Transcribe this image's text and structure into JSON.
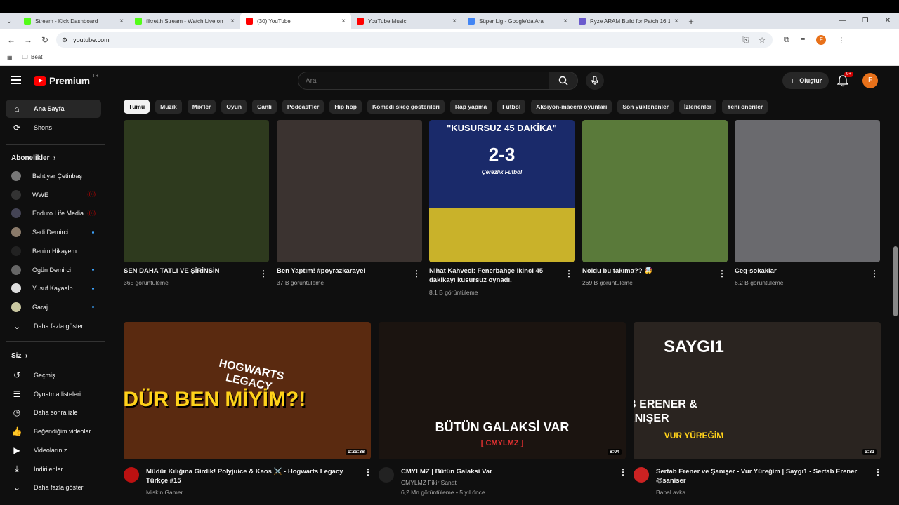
{
  "browser": {
    "tabs": [
      {
        "title": "Stream - Kick Dashboard",
        "color": "#53fc18",
        "active": false
      },
      {
        "title": "fikretth Stream - Watch Live on",
        "color": "#53fc18",
        "active": false
      },
      {
        "title": "(30) YouTube",
        "color": "#ff0000",
        "active": true
      },
      {
        "title": "YouTube Music",
        "color": "#ff0000",
        "active": false
      },
      {
        "title": "Süper Lig - Google'da Ara",
        "color": "#4285f4",
        "active": false
      },
      {
        "title": "Ryze ARAM Build for Patch 16.1",
        "color": "#6a5acd",
        "active": false
      }
    ],
    "url": "youtube.com",
    "bookmark": "Beat",
    "profile_initial": "F"
  },
  "header": {
    "logo": "Premium",
    "logo_sup": "TR",
    "search_placeholder": "Ara",
    "create_label": "Oluştur",
    "notif_badge": "9+",
    "avatar_initial": "F"
  },
  "sidebar": {
    "main": [
      {
        "label": "Ana Sayfa",
        "icon": "home-icon"
      },
      {
        "label": "Shorts",
        "icon": "shorts-icon"
      }
    ],
    "subs_title": "Abonelikler",
    "subs": [
      {
        "label": "Bahtiyar Çetinbaş",
        "color": "#777",
        "status": ""
      },
      {
        "label": "WWE",
        "color": "#333",
        "status": "live"
      },
      {
        "label": "Enduro Life Media",
        "color": "#445",
        "status": "live"
      },
      {
        "label": "Sadi Demirci",
        "color": "#8a7a6a",
        "status": "dot"
      },
      {
        "label": "Benim Hikayem",
        "color": "#222",
        "status": ""
      },
      {
        "label": "Ogün Demirci",
        "color": "#666",
        "status": "dot"
      },
      {
        "label": "Yusuf Kayaalp",
        "color": "#ddd",
        "status": "dot"
      },
      {
        "label": "Garaj",
        "color": "#c9c7a0",
        "status": "dot"
      }
    ],
    "subs_more": "Daha fazla göster",
    "you_title": "Siz",
    "you": [
      {
        "label": "Geçmiş",
        "icon": "history-icon"
      },
      {
        "label": "Oynatma listeleri",
        "icon": "playlist-icon"
      },
      {
        "label": "Daha sonra izle",
        "icon": "clock-icon"
      },
      {
        "label": "Beğendiğim videolar",
        "icon": "thumbs-up-icon"
      },
      {
        "label": "Videolarınız",
        "icon": "video-icon"
      },
      {
        "label": "İndirilenler",
        "icon": "download-icon"
      },
      {
        "label": "Daha fazla göster",
        "icon": "chevron-down-icon"
      }
    ]
  },
  "chips": [
    "Tümü",
    "Müzik",
    "Mix'ler",
    "Oyun",
    "Canlı",
    "Podcast'ler",
    "Hip hop",
    "Komedi skeç gösterileri",
    "Rap yapma",
    "Futbol",
    "Aksiyon-macera oyunları",
    "Son yüklenenler",
    "İzlenenler",
    "Yeni öneriler"
  ],
  "shorts": [
    {
      "title": "SEN DAHA TATLI VE ŞİRİNSİN",
      "meta": "365 görüntüleme",
      "bg": "#2e3a1e"
    },
    {
      "title": "Ben Yaptım! #poyrazkarayel",
      "meta": "37 B görüntüleme",
      "bg": "#3b3330"
    },
    {
      "title": "Nihat Kahveci: Fenerbahçe ikinci 45 dakikayı kusursuz oynadı.",
      "meta": "8,1 B görüntüleme",
      "bg": "#1a2a6a",
      "overlay_top": "\"KUSURSUZ 45 DAKİKA\"",
      "overlay_score": "2-3",
      "overlay_sub": "Çerezlik Futbol"
    },
    {
      "title": "Noldu bu takıma?? 🤯",
      "meta": "269 B görüntüleme",
      "bg": "#5a7a3a"
    },
    {
      "title": "Ceg-sokaklar",
      "meta": "6,2 B görüntüleme",
      "bg": "#6a6a6e"
    }
  ],
  "videos": [
    {
      "title": "Müdür Kılığına Girdik! Polyjuice & Kaos ⚔️ - Hogwarts Legacy Türkçe  #15",
      "channel": "Miskin Gamer",
      "meta": "",
      "duration": "1:25:38",
      "bg": "#5a2a10",
      "overlay_main": "MÜDÜR BEN MİYİM?!",
      "overlay_side": "HOGWARTS LEGACY",
      "av": "#b11"
    },
    {
      "title": "CMYLMZ | Bütün Galaksi Var",
      "channel": "CMYLMZ Fikir Sanat",
      "meta": "6,2 Mn görüntüleme • 5 yıl önce",
      "duration": "8:04",
      "bg": "#1b1410",
      "overlay_main": "BÜTÜN GALAKSİ VAR",
      "overlay_side": "[ CMYLMZ ]",
      "av": "#222"
    },
    {
      "title": "Sertab Erener ve Şanışer - Vur Yüreğim | Saygı1 - Sertab Erener @saniser",
      "channel": "Babal avka",
      "meta": "",
      "duration": "5:31",
      "bg": "#2a2420",
      "overlay_main": "SERTAB ERENER & ŞANIŞER",
      "overlay_side": "VUR YÜREĞİM",
      "overlay_top": "SAYGI1",
      "av": "#c22"
    }
  ]
}
